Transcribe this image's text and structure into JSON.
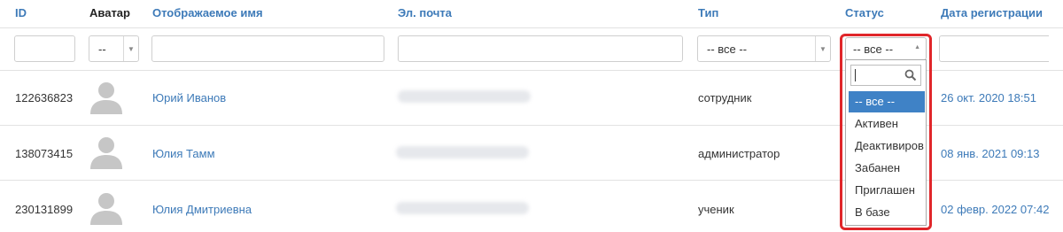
{
  "columns": {
    "id": "ID",
    "avatar": "Аватар",
    "name": "Отображаемое имя",
    "email": "Эл. почта",
    "type": "Тип",
    "status": "Статус",
    "registered": "Дата регистрации"
  },
  "filters": {
    "avatar_value": "--",
    "type_value": "-- все --",
    "status_value": "-- все --"
  },
  "status_options": [
    "-- все --",
    "Активен",
    "Деактивиров",
    "Забанен",
    "Приглашен",
    "В базе"
  ],
  "rows": [
    {
      "id": "122636823",
      "name": "Юрий Иванов",
      "type": "сотрудник",
      "date": "26 окт. 2020 18:51"
    },
    {
      "id": "138073415",
      "name": "Юлия Тамм",
      "type": "администратор",
      "date": "08 янв. 2021 09:13"
    },
    {
      "id": "230131899",
      "name": "Юлия Дмитриевна",
      "type": "ученик",
      "date": "02 февр. 2022 07:42"
    }
  ],
  "colors": {
    "link": "#3d7ab8",
    "selected_option": "#3f82c6",
    "highlight": "#e0262a"
  }
}
